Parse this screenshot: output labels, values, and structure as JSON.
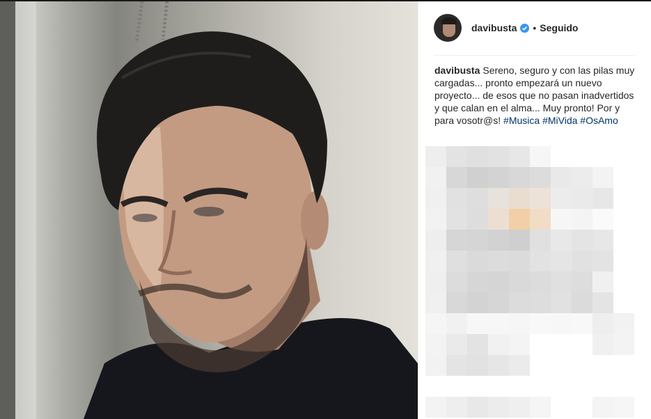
{
  "post": {
    "username": "davibusta",
    "follow_status": "Seguido",
    "dot": "•",
    "caption_text": "Sereno, seguro y con las pilas muy cargadas... pronto empezará un nuevo proyecto... de esos que no pasan inadvertidos y que calan en el alma... Muy pronto! Por y para vosotr@s!",
    "hashtags": [
      "#Musica",
      "#MiVida",
      "#OsAmo"
    ]
  },
  "colors": {
    "hashtag": "#003569",
    "verified": "#3897f0",
    "text": "#262626"
  },
  "icons": {
    "verified": "verified-badge-icon"
  }
}
